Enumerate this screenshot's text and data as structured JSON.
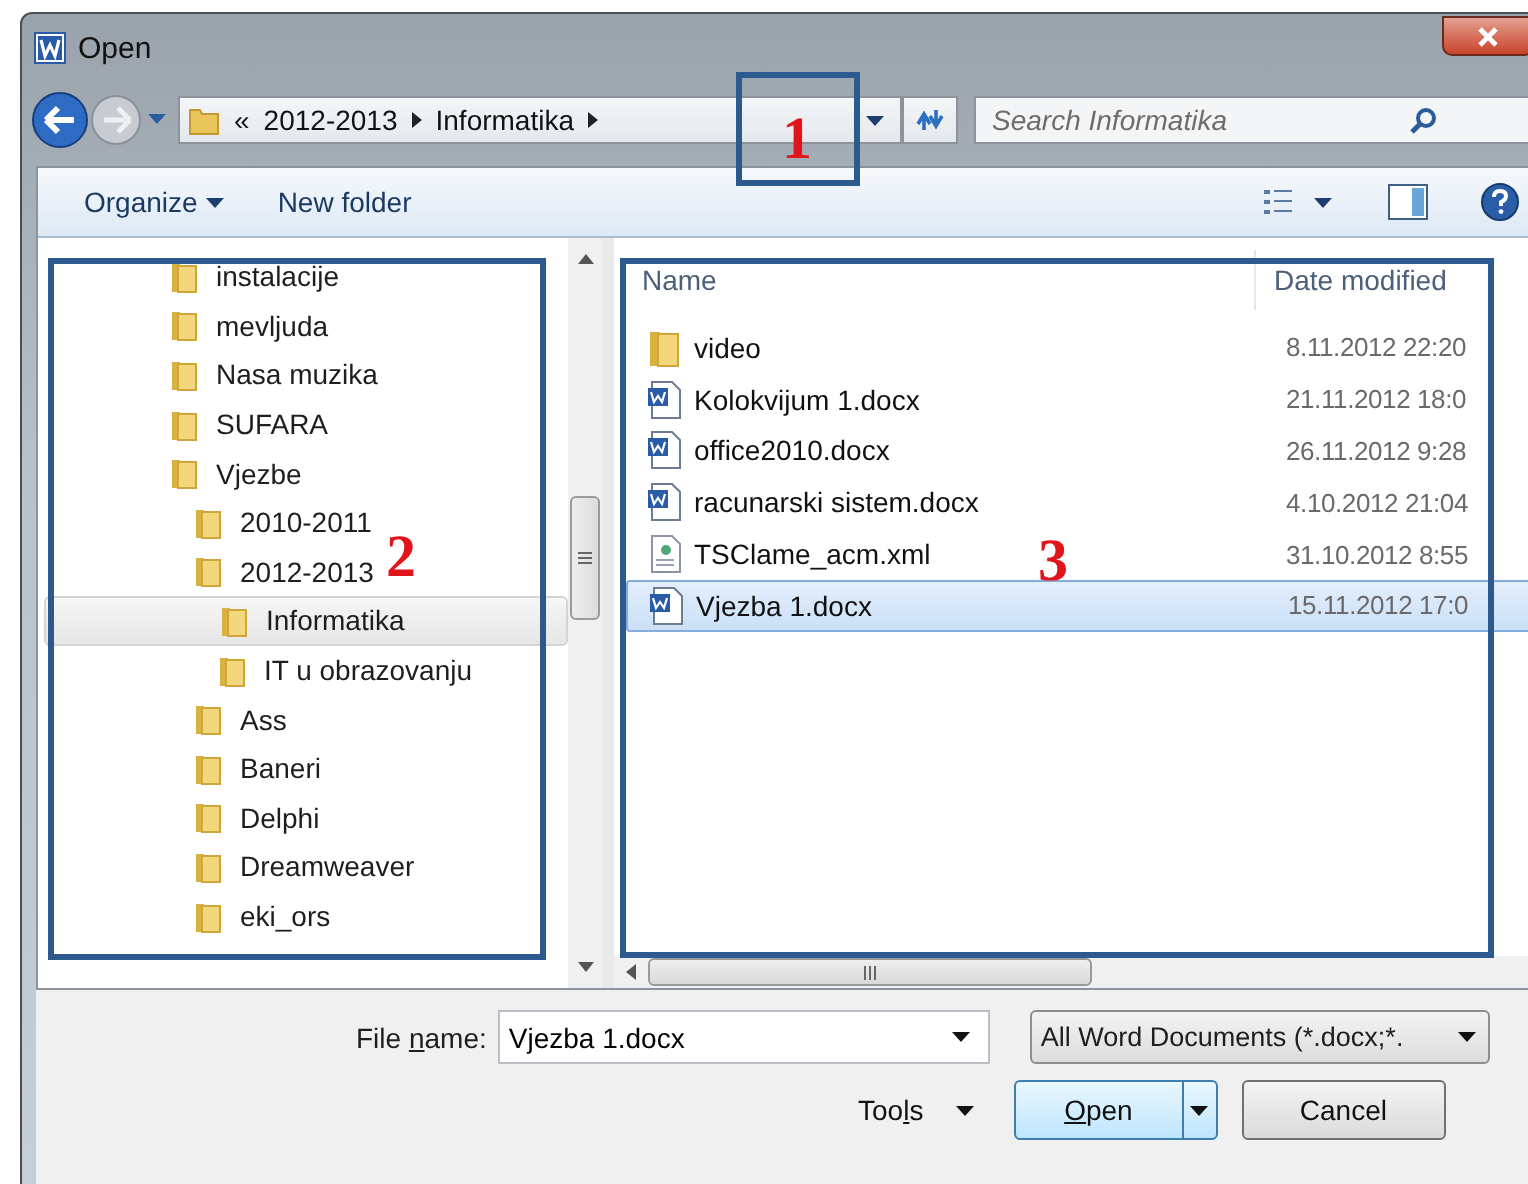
{
  "window": {
    "title": "Open"
  },
  "address": {
    "overflow": "«",
    "crumbs": [
      "2012-2013",
      "Informatika"
    ]
  },
  "search": {
    "placeholder": "Search Informatika"
  },
  "toolbar": {
    "organize": "Organize",
    "new_folder": "New folder"
  },
  "tree": [
    {
      "label": "instalacije",
      "selected": false
    },
    {
      "label": "mevljuda",
      "selected": false
    },
    {
      "label": "Nasa muzika",
      "selected": false
    },
    {
      "label": "SUFARA",
      "selected": false
    },
    {
      "label": "Vjezbe",
      "selected": false,
      "children": [
        {
          "label": "2010-2011",
          "selected": false
        },
        {
          "label": "2012-2013",
          "selected": false,
          "children": [
            {
              "label": "Informatika",
              "selected": true
            },
            {
              "label": "IT u obrazovanju",
              "selected": false
            }
          ]
        },
        {
          "label": "Ass",
          "selected": false
        },
        {
          "label": "Baneri",
          "selected": false
        },
        {
          "label": "Delphi",
          "selected": false
        },
        {
          "label": "Dreamweaver",
          "selected": false
        },
        {
          "label": "eki_ors",
          "selected": false
        }
      ]
    }
  ],
  "files": {
    "columns": [
      "Name",
      "Date modified"
    ],
    "rows": [
      {
        "kind": "folder",
        "name": "video",
        "date": "8.11.2012 22:20",
        "selected": false
      },
      {
        "kind": "word",
        "name": "Kolokvijum 1.docx",
        "date": "21.11.2012 18:0",
        "selected": false
      },
      {
        "kind": "word",
        "name": "office2010.docx",
        "date": "26.11.2012 9:28",
        "selected": false
      },
      {
        "kind": "word",
        "name": "racunarski sistem.docx",
        "date": "4.10.2012 21:04",
        "selected": false
      },
      {
        "kind": "xml",
        "name": "TSClame_acm.xml",
        "date": "31.10.2012 8:55",
        "selected": false
      },
      {
        "kind": "word",
        "name": "Vjezba 1.docx",
        "date": "15.11.2012 17:0",
        "selected": true
      }
    ]
  },
  "footer": {
    "file_name_label": {
      "before": "File ",
      "access_key": "n",
      "after": "ame:"
    },
    "file_name": "Vjezba 1.docx",
    "file_type": "All Word Documents (*.docx;*.",
    "tools": {
      "before": "Too",
      "access_key": "l",
      "after": "s"
    },
    "open": {
      "access_key": "O",
      "after": "pen"
    },
    "cancel": "Cancel"
  },
  "annotations": [
    {
      "label": "1"
    },
    {
      "label": "2"
    },
    {
      "label": "3"
    }
  ]
}
